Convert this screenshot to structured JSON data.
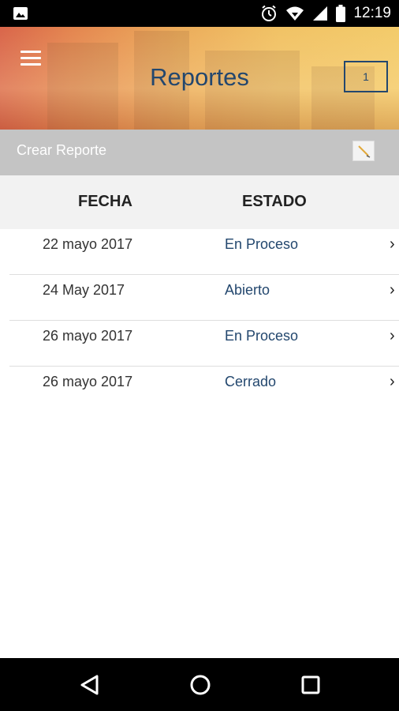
{
  "status_bar": {
    "time": "12:19",
    "icons": [
      "image-icon",
      "alarm-icon",
      "wifi-icon",
      "signal-icon",
      "battery-icon"
    ]
  },
  "header": {
    "title": "Reportes",
    "badge": "1",
    "menu_icon": "hamburger-menu-icon"
  },
  "create_bar": {
    "label": "Crear Reporte",
    "icon": "edit-icon"
  },
  "table": {
    "columns": [
      "FECHA",
      "ESTADO"
    ],
    "rows": [
      {
        "fecha": "22 mayo 2017",
        "estado": "En Proceso"
      },
      {
        "fecha": "24 May 2017",
        "estado": "Abierto"
      },
      {
        "fecha": "26 mayo 2017",
        "estado": "En Proceso"
      },
      {
        "fecha": "26 mayo 2017",
        "estado": "Cerrado"
      }
    ],
    "row_chevron": "›"
  },
  "nav_bar": {
    "buttons": [
      "back-triangle-icon",
      "home-circle-icon",
      "recents-square-icon"
    ]
  },
  "colors": {
    "accent": "#23476e",
    "create_bar_bg": "#c4c4c4",
    "table_head_bg": "#f2f2f2"
  }
}
